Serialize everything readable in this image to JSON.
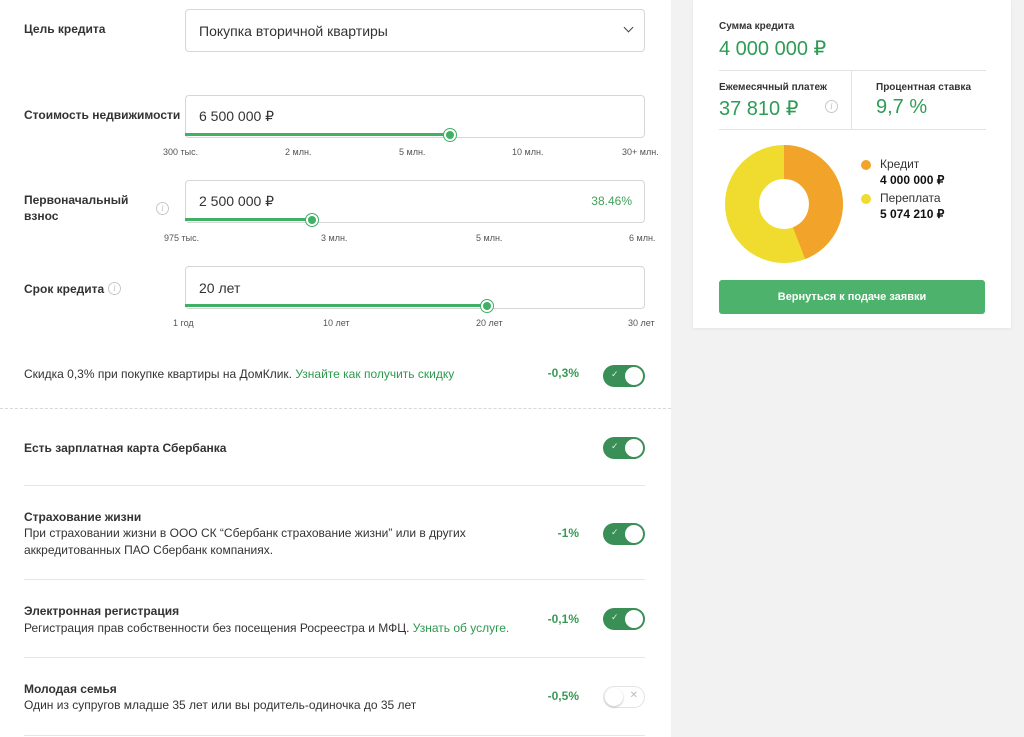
{
  "form": {
    "purpose": {
      "label": "Цель кредита",
      "value": "Покупка вторичной квартиры"
    },
    "price": {
      "label": "Стоимость недвижимости",
      "value": "6 500 000 ₽",
      "ticks": [
        "300 тыс.",
        "2 млн.",
        "5 млн.",
        "10 млн.",
        "30+ млн."
      ]
    },
    "down": {
      "label": "Первоначальный взнос",
      "value": "2 500 000 ₽",
      "percent": "38.46%",
      "ticks": [
        "975 тыс.",
        "3 млн.",
        "5 млн.",
        "6 млн."
      ]
    },
    "term": {
      "label": "Срок кредита",
      "value": "20 лет",
      "ticks": [
        "1 год",
        "10 лет",
        "20 лет",
        "30 лет"
      ]
    },
    "icons": {
      "info": "info-icon",
      "chevron": "chevron-down-icon"
    }
  },
  "options": [
    {
      "title": "",
      "desc": "Скидка 0,3% при покупке квартиры на ДомКлик.",
      "link": "Узнайте как получить скидку",
      "discount": "-0,3%",
      "on": true
    },
    {
      "title": "Есть зарплатная карта Сбербанка",
      "desc": "",
      "link": "",
      "discount": "",
      "on": true
    },
    {
      "title": "Страхование жизни",
      "desc": "При страховании жизни в ООО СК “Сбербанк страхование жизни” или в других аккредитованных ПАО Сбербанк компаниях.",
      "link": "",
      "discount": "-1%",
      "on": true
    },
    {
      "title": "Электронная регистрация",
      "desc": "Регистрация прав собственности без посещения Росреестра и МФЦ.",
      "link": "Узнать об услуге.",
      "discount": "-0,1%",
      "on": true
    },
    {
      "title": "Молодая семья",
      "desc": "Один из супругов младше 35 лет или вы родитель-одиночка до 35 лет",
      "link": "",
      "discount": "-0,5%",
      "on": false
    }
  ],
  "summary": {
    "loan_label": "Сумма кредита",
    "loan_value": "4 000 000 ₽",
    "monthly_label": "Ежемесячный платеж",
    "monthly_value": "37 810 ₽",
    "rate_label": "Процентная ставка",
    "rate_value": "9,7 %",
    "legend": [
      {
        "name": "Кредит",
        "value": "4 000 000 ₽",
        "color": "#f2a32a"
      },
      {
        "name": "Переплата",
        "value": "5 074 210 ₽",
        "color": "#f0dc2e"
      }
    ],
    "button": "Вернуться к подаче заявки"
  },
  "colors": {
    "accent": "#3fb066",
    "credit": "#f2a32a",
    "overpay": "#f0dc2e",
    "button": "#4db26c"
  }
}
